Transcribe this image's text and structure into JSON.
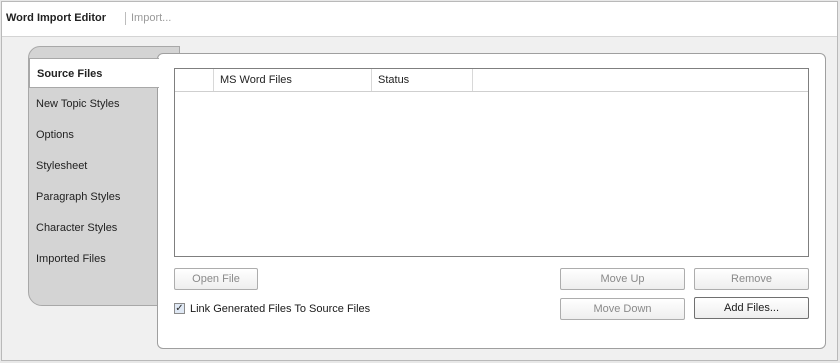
{
  "header": {
    "title": "Word Import Editor",
    "subtitle": "Import..."
  },
  "tabs": [
    {
      "label": "Source Files",
      "active": true
    },
    {
      "label": "New Topic Styles",
      "active": false
    },
    {
      "label": "Options",
      "active": false
    },
    {
      "label": "Stylesheet",
      "active": false
    },
    {
      "label": "Paragraph Styles",
      "active": false
    },
    {
      "label": "Character Styles",
      "active": false
    },
    {
      "label": "Imported Files",
      "active": false
    }
  ],
  "files_list": {
    "columns": [
      "",
      "MS Word Files",
      "Status",
      ""
    ],
    "rows": []
  },
  "buttons": {
    "open_file": "Open File",
    "move_up": "Move Up",
    "remove": "Remove",
    "move_down": "Move Down",
    "add_files": "Add Files..."
  },
  "link_option": {
    "label": "Link Generated Files To Source Files",
    "checked": true,
    "mark": "✓"
  }
}
